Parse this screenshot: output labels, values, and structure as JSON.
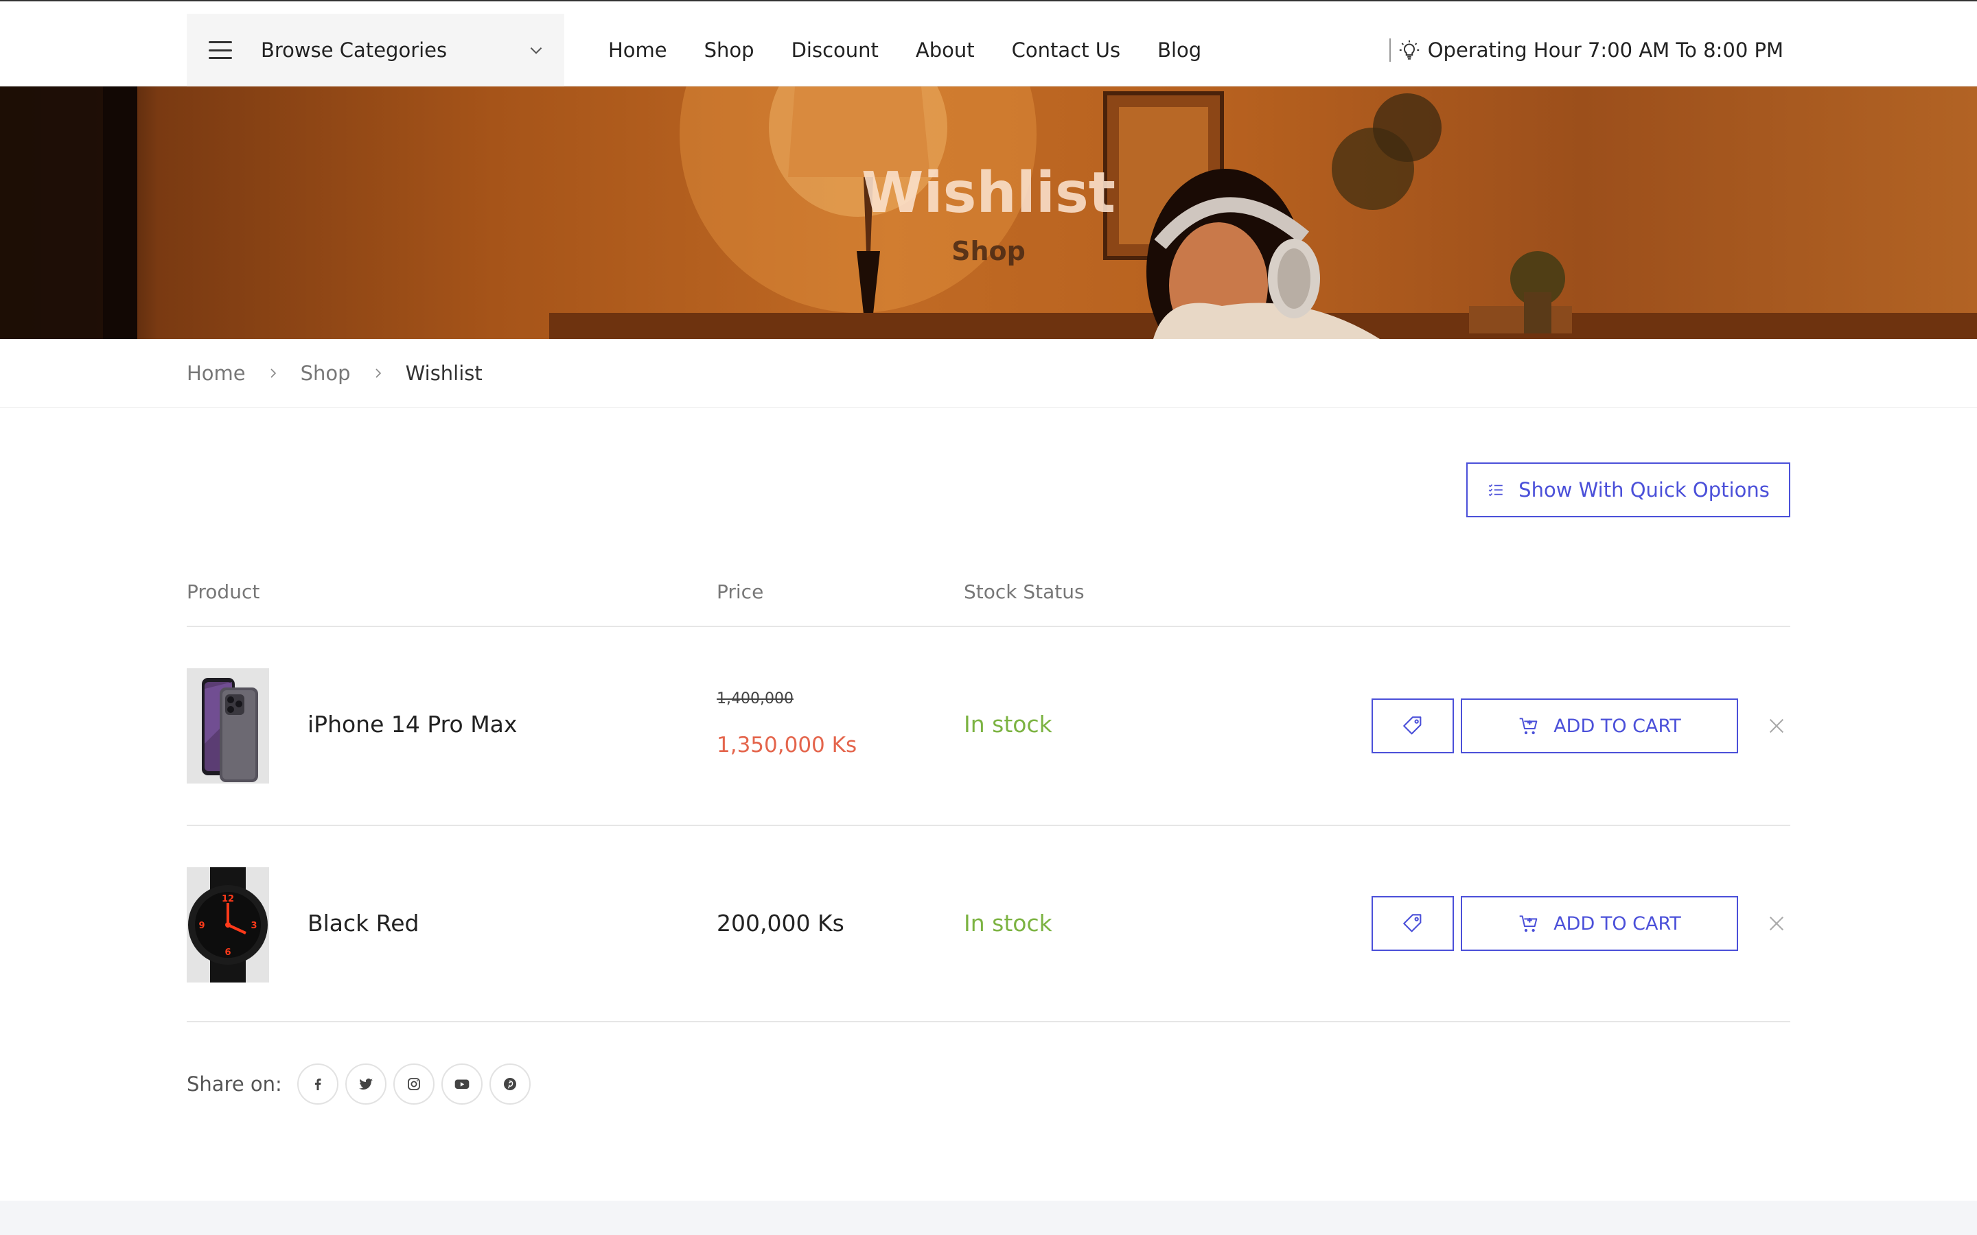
{
  "header": {
    "browse_label": "Browse Categories",
    "nav": [
      "Home",
      "Shop",
      "Discount",
      "About",
      "Contact Us",
      "Blog"
    ],
    "operating_hours": "Operating Hour 7:00 AM To 8:00 PM"
  },
  "hero": {
    "title": "Wishlist",
    "subtitle": "Shop"
  },
  "breadcrumb": [
    "Home",
    "Shop",
    "Wishlist"
  ],
  "quick_options_label": "Show With Quick Options",
  "table": {
    "columns": [
      "Product",
      "Price",
      "Stock Status"
    ],
    "rows": [
      {
        "name": "iPhone 14 Pro Max",
        "price_old": "1,400,000",
        "price_new": "1,350,000 Ks",
        "stock": "In stock",
        "add_to_cart": "ADD TO CART"
      },
      {
        "name": "Black Red",
        "price": "200,000 Ks",
        "stock": "In stock",
        "add_to_cart": "ADD TO CART"
      }
    ]
  },
  "share": {
    "label": "Share on:",
    "networks": [
      "facebook-icon",
      "twitter-icon",
      "instagram-icon",
      "youtube-icon",
      "pinterest-icon"
    ]
  },
  "colors": {
    "accent": "#4b50d9",
    "sale_price": "#e4654c",
    "in_stock": "#7cb342"
  }
}
